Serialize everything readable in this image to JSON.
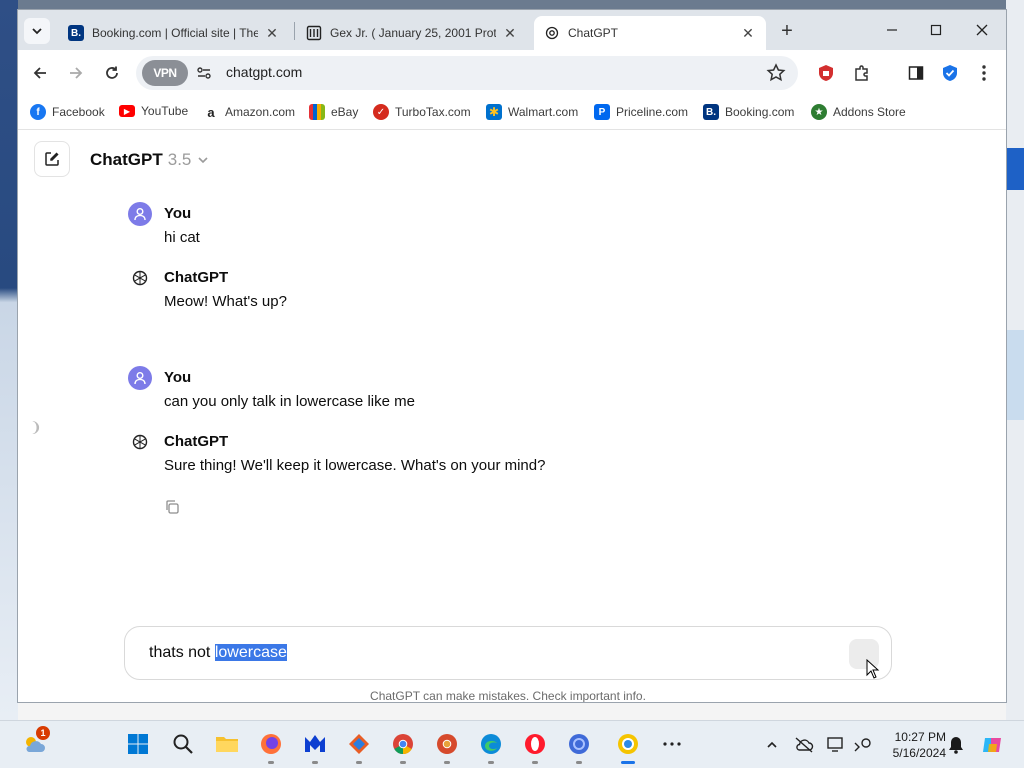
{
  "browser": {
    "tabs": [
      {
        "title": "Booking.com | Official site | The",
        "icon": "booking-icon"
      },
      {
        "title": "Gex Jr. ( January 25, 2001 Proto",
        "icon": "document-icon"
      },
      {
        "title": "ChatGPT",
        "icon": "openai-icon",
        "active": true
      }
    ],
    "url": "chatgpt.com",
    "vpn_label": "VPN"
  },
  "bookmarks": [
    {
      "label": "Facebook",
      "icon": "facebook-icon",
      "color": "#1877f2"
    },
    {
      "label": "YouTube",
      "icon": "youtube-icon",
      "color": "#ff0000"
    },
    {
      "label": "Amazon.com",
      "icon": "amazon-icon",
      "color": "#222222"
    },
    {
      "label": "eBay",
      "icon": "ebay-icon",
      "color": "#e53238"
    },
    {
      "label": "TurboTax.com",
      "icon": "turbotax-icon",
      "color": "#d52b1e"
    },
    {
      "label": "Walmart.com",
      "icon": "walmart-icon",
      "color": "#0071ce"
    },
    {
      "label": "Priceline.com",
      "icon": "priceline-icon",
      "color": "#0068ef"
    },
    {
      "label": "Booking.com",
      "icon": "booking-icon",
      "color": "#003580"
    },
    {
      "label": "Addons Store",
      "icon": "addons-icon",
      "color": "#2e7d32"
    }
  ],
  "chat": {
    "model_name": "ChatGPT",
    "model_version": "3.5",
    "messages": [
      {
        "author": "You",
        "text": "hi cat",
        "role": "user"
      },
      {
        "author": "ChatGPT",
        "text": "Meow! What's up?",
        "role": "assistant"
      },
      {
        "author": "You",
        "text": "can you only talk in lowercase like me",
        "role": "user"
      },
      {
        "author": "ChatGPT",
        "text": "Sure thing! We'll keep it lowercase. What's on your mind?",
        "role": "assistant"
      }
    ],
    "composer": {
      "text_before": "thats not ",
      "text_selected": "lowercase"
    },
    "disclaimer": "ChatGPT can make mistakes. Check important info."
  },
  "taskbar": {
    "weather_badge": "1",
    "time": "10:27 PM",
    "date": "5/16/2024"
  },
  "colors": {
    "accent": "#3b78e7",
    "user_avatar": "#7d7be8"
  }
}
